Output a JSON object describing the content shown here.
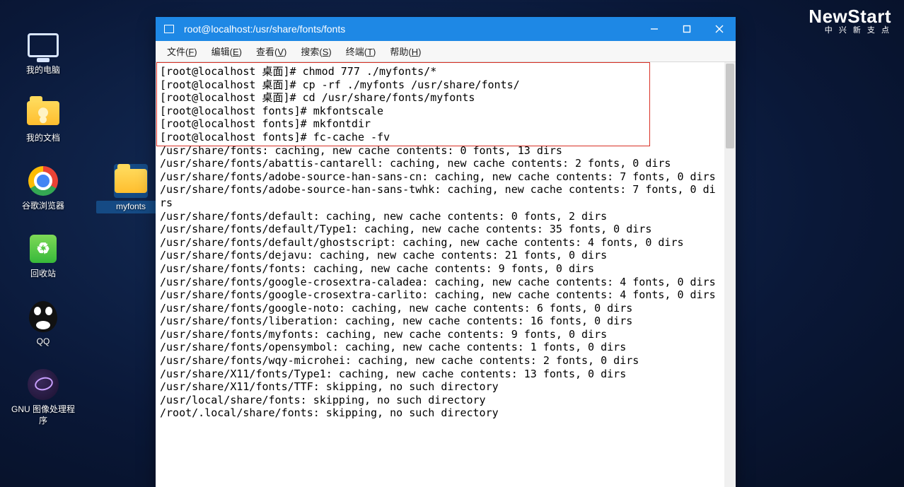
{
  "logo": {
    "brand": "NewStart",
    "tagline": "中 兴 新 支 点"
  },
  "desktop_icons": {
    "computer": "我的电脑",
    "documents": "我的文档",
    "chrome": "谷歌浏览器",
    "trash": "回收站",
    "qq": "QQ",
    "gimp": "GNU 图像处理程序",
    "myfonts": "myfonts"
  },
  "window": {
    "title": "root@localhost:/usr/share/fonts/fonts",
    "menus": [
      {
        "label": "文件",
        "accel": "F"
      },
      {
        "label": "编辑",
        "accel": "E"
      },
      {
        "label": "查看",
        "accel": "V"
      },
      {
        "label": "搜索",
        "accel": "S"
      },
      {
        "label": "终端",
        "accel": "T"
      },
      {
        "label": "帮助",
        "accel": "H"
      }
    ]
  },
  "terminal_lines": [
    "[root@localhost 桌面]# chmod 777 ./myfonts/*",
    "[root@localhost 桌面]# cp -rf ./myfonts /usr/share/fonts/",
    "[root@localhost 桌面]# cd /usr/share/fonts/myfonts",
    "[root@localhost fonts]# mkfontscale",
    "[root@localhost fonts]# mkfontdir",
    "[root@localhost fonts]# fc-cache -fv",
    "/usr/share/fonts: caching, new cache contents: 0 fonts, 13 dirs",
    "/usr/share/fonts/abattis-cantarell: caching, new cache contents: 2 fonts, 0 dirs",
    "/usr/share/fonts/adobe-source-han-sans-cn: caching, new cache contents: 7 fonts, 0 dirs",
    "/usr/share/fonts/adobe-source-han-sans-twhk: caching, new cache contents: 7 fonts, 0 dirs",
    "/usr/share/fonts/default: caching, new cache contents: 0 fonts, 2 dirs",
    "/usr/share/fonts/default/Type1: caching, new cache contents: 35 fonts, 0 dirs",
    "/usr/share/fonts/default/ghostscript: caching, new cache contents: 4 fonts, 0 dirs",
    "/usr/share/fonts/dejavu: caching, new cache contents: 21 fonts, 0 dirs",
    "/usr/share/fonts/fonts: caching, new cache contents: 9 fonts, 0 dirs",
    "/usr/share/fonts/google-crosextra-caladea: caching, new cache contents: 4 fonts, 0 dirs",
    "/usr/share/fonts/google-crosextra-carlito: caching, new cache contents: 4 fonts, 0 dirs",
    "/usr/share/fonts/google-noto: caching, new cache contents: 6 fonts, 0 dirs",
    "/usr/share/fonts/liberation: caching, new cache contents: 16 fonts, 0 dirs",
    "/usr/share/fonts/myfonts: caching, new cache contents: 9 fonts, 0 dirs",
    "/usr/share/fonts/opensymbol: caching, new cache contents: 1 fonts, 0 dirs",
    "/usr/share/fonts/wqy-microhei: caching, new cache contents: 2 fonts, 0 dirs",
    "/usr/share/X11/fonts/Type1: caching, new cache contents: 13 fonts, 0 dirs",
    "/usr/share/X11/fonts/TTF: skipping, no such directory",
    "/usr/local/share/fonts: skipping, no such directory",
    "/root/.local/share/fonts: skipping, no such directory"
  ]
}
